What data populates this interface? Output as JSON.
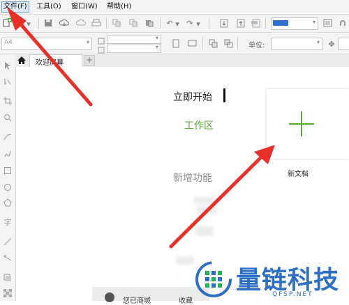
{
  "menubar": {
    "items": [
      {
        "label": "文件(F)",
        "active": true
      },
      {
        "label": "工具(O)",
        "active": false
      },
      {
        "label": "窗口(W)",
        "active": false
      },
      {
        "label": "帮助(H)",
        "active": false
      }
    ]
  },
  "toolbar2": {
    "page_size_value": "A4",
    "units_label": "单位:"
  },
  "tabs": [
    {
      "label": "欢迎屏幕"
    }
  ],
  "welcome": {
    "nav": [
      {
        "label": "立即开始",
        "active": true
      },
      {
        "label": "工作区",
        "active": false
      },
      {
        "label": "新增功能",
        "active": false
      }
    ],
    "new_document_label": "新文档",
    "bottom_partial_1": "您已商城",
    "bottom_partial_2": "收藏"
  },
  "watermark": {
    "text": "量链科技",
    "subtext": "QFSP.NET"
  },
  "colors": {
    "accent_green": "#5ba83a",
    "arrow_red": "#e8302a",
    "active_menu_border": "#6f9fd8",
    "watermark_blue": "#2c6fc4",
    "watermark_green": "#25b05a"
  }
}
